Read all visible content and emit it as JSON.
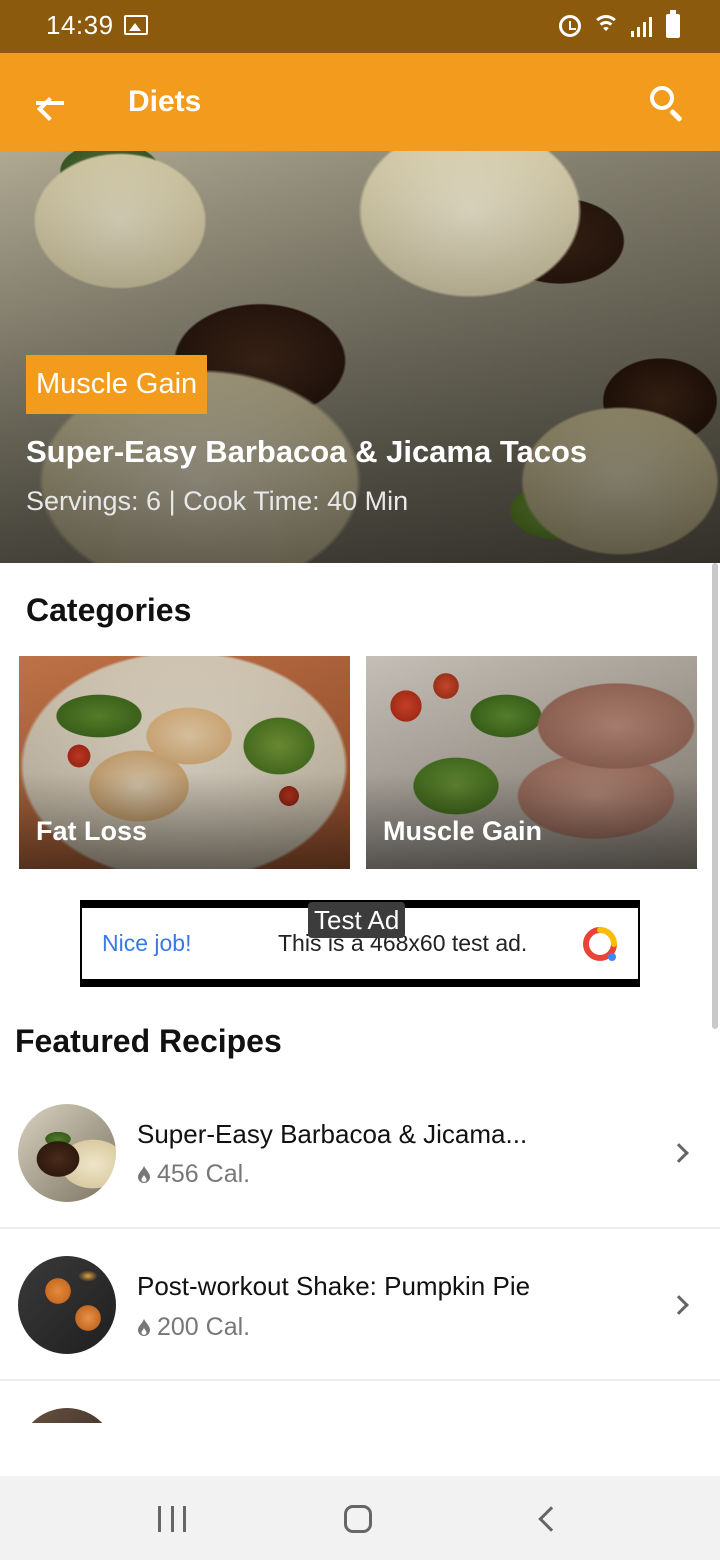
{
  "status_bar": {
    "time": "14:39"
  },
  "app_bar": {
    "title": "Diets"
  },
  "hero": {
    "badge": "Muscle Gain",
    "title": "Super-Easy Barbacoa & Jicama Tacos",
    "meta": "Servings: 6 | Cook Time: 40 Min"
  },
  "categories": {
    "title": "Categories",
    "items": [
      {
        "label": "Fat Loss"
      },
      {
        "label": "Muscle Gain"
      }
    ]
  },
  "ad": {
    "label": "Test Ad",
    "headline": "Nice job!",
    "text": "This is a 468x60 test ad."
  },
  "featured": {
    "title": "Featured Recipes",
    "items": [
      {
        "name": "Super-Easy Barbacoa & Jicama...",
        "calories": "456 Cal."
      },
      {
        "name": "Post-workout Shake: Pumpkin Pie",
        "calories": "200 Cal."
      }
    ]
  },
  "colors": {
    "accent": "#f29b1c",
    "status_bar": "#8b5a0c",
    "ad_link": "#3b78e7"
  },
  "icons": {
    "back": "arrow-left-icon",
    "search": "search-icon",
    "calories": "flame-icon",
    "row_action": "chevron-right-icon"
  }
}
